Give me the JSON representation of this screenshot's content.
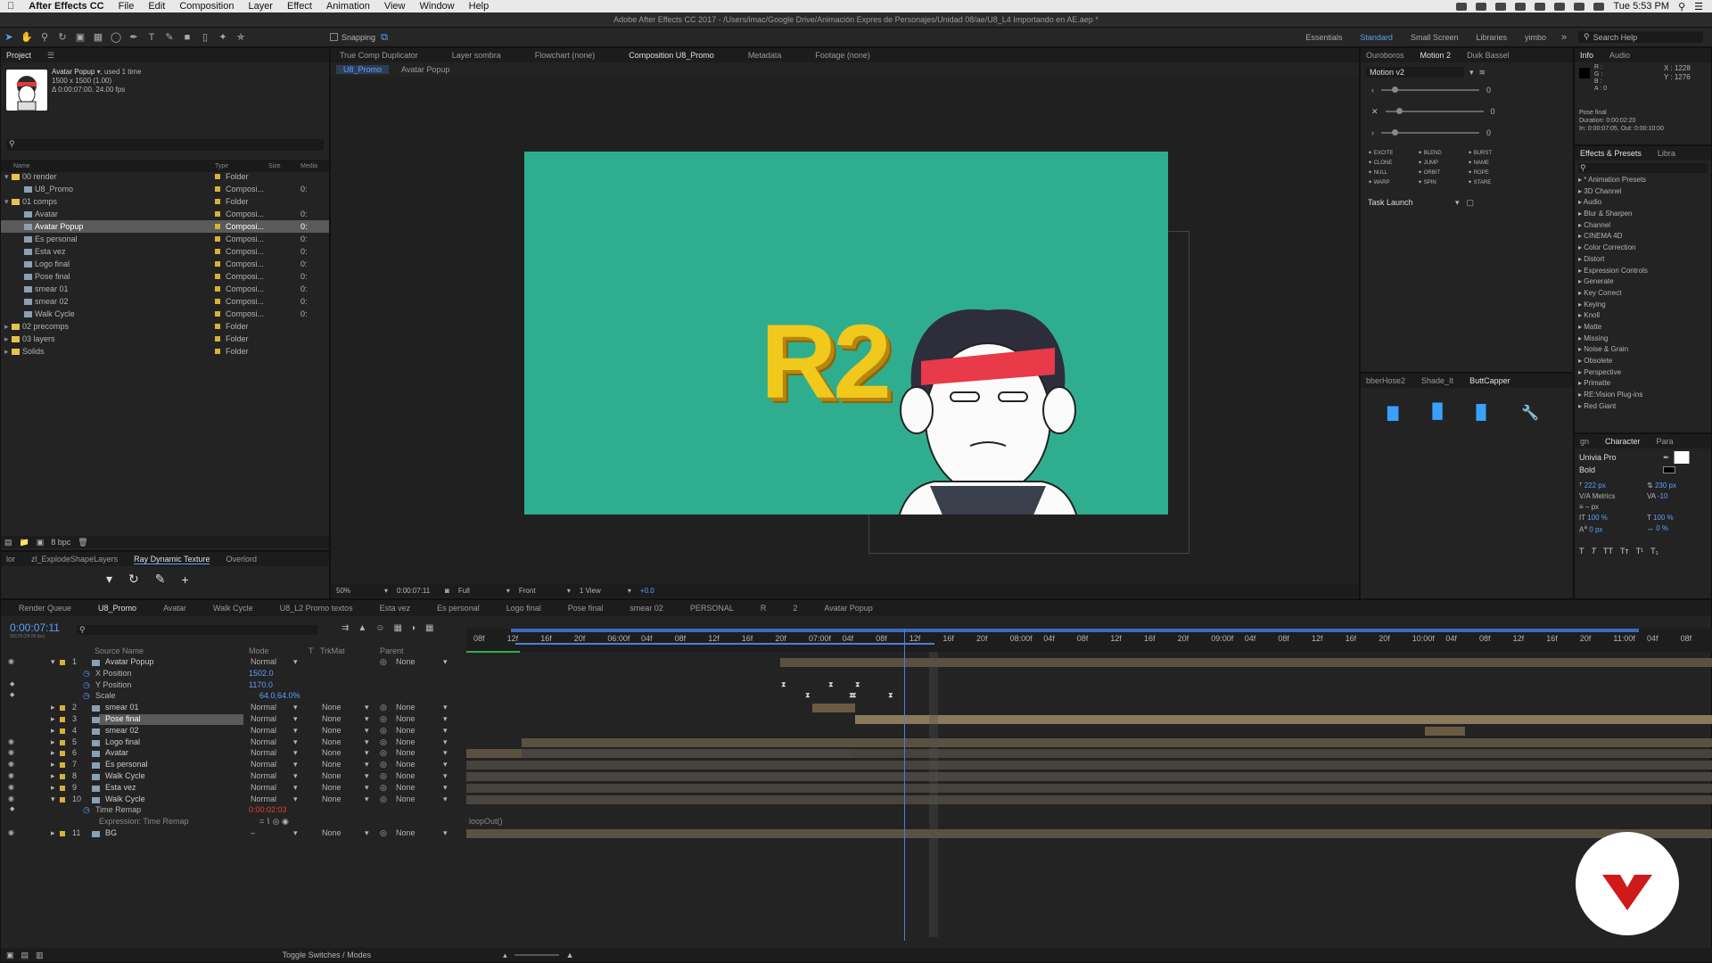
{
  "menubar": {
    "app": "After Effects CC",
    "items": [
      "File",
      "Edit",
      "Composition",
      "Layer",
      "Effect",
      "Animation",
      "View",
      "Window",
      "Help"
    ],
    "clock": "Tue 5:53 PM"
  },
  "window_title": "Adobe After Effects CC 2017 - /Users/imac/Google Drive/Animación Expres de Personajes/Unidad 08/ae/U8_L4 Importando en AE.aep *",
  "toolbar": {
    "snapping": "Snapping",
    "workspaces": [
      "Essentials",
      "Standard",
      "Small Screen",
      "Libraries",
      "yimbo"
    ],
    "active_workspace": "Standard",
    "search_help": "Search Help"
  },
  "project": {
    "tab": "Project",
    "selected_name": "Avatar Popup",
    "used": ", used 1 time",
    "dims": "1500 x 1500 (1.00)",
    "duration": "Δ 0:00:07:00, 24.00 fps",
    "columns": [
      "Name",
      "Type",
      "Size",
      "Media"
    ],
    "items": [
      {
        "indent": 0,
        "name": "00 render",
        "type": "Folder",
        "kind": "folder",
        "open": true
      },
      {
        "indent": 1,
        "name": "U8_Promo",
        "type": "Composi...",
        "kind": "comp",
        "media": "0:"
      },
      {
        "indent": 0,
        "name": "01 comps",
        "type": "Folder",
        "kind": "folder",
        "open": true
      },
      {
        "indent": 1,
        "name": "Avatar",
        "type": "Composi...",
        "kind": "comp",
        "media": "0:"
      },
      {
        "indent": 1,
        "name": "Avatar Popup",
        "type": "Composi...",
        "kind": "comp",
        "media": "0:",
        "selected": true
      },
      {
        "indent": 1,
        "name": "Es personal",
        "type": "Composi...",
        "kind": "comp",
        "media": "0:"
      },
      {
        "indent": 1,
        "name": "Esta vez",
        "type": "Composi...",
        "kind": "comp",
        "media": "0:"
      },
      {
        "indent": 1,
        "name": "Logo final",
        "type": "Composi...",
        "kind": "comp",
        "media": "0:"
      },
      {
        "indent": 1,
        "name": "Pose final",
        "type": "Composi...",
        "kind": "comp",
        "media": "0:"
      },
      {
        "indent": 1,
        "name": "smear 01",
        "type": "Composi...",
        "kind": "comp",
        "media": "0:"
      },
      {
        "indent": 1,
        "name": "smear 02",
        "type": "Composi...",
        "kind": "comp",
        "media": "0:"
      },
      {
        "indent": 1,
        "name": "Walk Cycle",
        "type": "Composi...",
        "kind": "comp",
        "media": "0:"
      },
      {
        "indent": 0,
        "name": "02 precomps",
        "type": "Folder",
        "kind": "folder"
      },
      {
        "indent": 0,
        "name": "03 layers",
        "type": "Folder",
        "kind": "folder"
      },
      {
        "indent": 0,
        "name": "Solids",
        "type": "Folder",
        "kind": "folder"
      }
    ],
    "bpc": "8 bpc"
  },
  "bottom_left_tabs": [
    "lor",
    "zl_ExplodeShapeLayers",
    "Ray Dynamic Texture",
    "Overlord"
  ],
  "comp_viewer": {
    "tabs": [
      "True Comp Duplicator",
      "Layer sombra",
      "Flowchart (none)",
      "Composition U8_Promo",
      "Metadata",
      "Footage (none)"
    ],
    "breadcrumbs": [
      "U8_Promo",
      "Avatar Popup"
    ],
    "logo_text": "R2",
    "footer": {
      "zoom": "50%",
      "timecode": "0:00:07:11",
      "resolution": "Full",
      "view": "Front",
      "views": "1 View",
      "offset": "+0.0"
    }
  },
  "motion_panel": {
    "tabs": [
      "Ouroboros",
      "Motion 2",
      "Duik Bassel"
    ],
    "preset": "Motion v2",
    "slider_values": [
      "0",
      "0",
      "0"
    ],
    "buttons": [
      "EXCITE",
      "BLEND",
      "BURST",
      "CLONE",
      "JUMP",
      "NAME",
      "NULL",
      "ORBIT",
      "ROPE",
      "WARP",
      "SPIN",
      "STARE"
    ],
    "task": "Task Launch"
  },
  "butt_panel": {
    "tabs": [
      "bberHose2",
      "Shade_It",
      "ButtCapper"
    ]
  },
  "info_panel": {
    "tabs": [
      "Info",
      "Audio"
    ],
    "rgb": [
      "R :",
      "G :",
      "B :",
      "A : 0"
    ],
    "xy": [
      "X : 1228",
      "Y : 1276"
    ],
    "layer": "Pose final",
    "duration": "Duration: 0:00:02:20",
    "inout": "In: 0:00:07:05, Out: 0:00:10:00"
  },
  "effects_panel": {
    "tabs": [
      "Effects & Presets",
      "Libra"
    ],
    "items": [
      "* Animation Presets",
      "3D Channel",
      "Audio",
      "Blur & Sharpen",
      "Channel",
      "CINEMA 4D",
      "Color Correction",
      "Distort",
      "Expression Controls",
      "Generate",
      "Key Correct",
      "Keying",
      "Knoll",
      "Matte",
      "Missing",
      "Noise & Grain",
      "Obsolete",
      "Perspective",
      "Primatte",
      "RE:Vision Plug-ins",
      "Red Giant"
    ]
  },
  "character_panel": {
    "tabs": [
      "gn",
      "Character",
      "Para"
    ],
    "font": "Univia Pro",
    "style": "Bold",
    "size": "222 px",
    "leading": "230 px",
    "kern": "Metrics",
    "track": "-10",
    "stroke": "– px",
    "vscale": "100 %",
    "hscale": "100 %",
    "baseline": "0 px",
    "tsume": "0 %"
  },
  "timeline": {
    "tabs": [
      "Render Queue",
      "U8_Promo",
      "Avatar",
      "Walk Cycle",
      "U8_L2 Promo textos",
      "Esta vez",
      "Es personal",
      "Logo final",
      "Pose final",
      "smear 02",
      "PERSONAL",
      "R",
      "2",
      "Avatar Popup"
    ],
    "active_tab": "U8_Promo",
    "timecode": "0:00:07:11",
    "fps": "00179 (24.00 fps)",
    "headers": [
      "Source Name",
      "Mode",
      "T",
      "TrkMat",
      "Parent"
    ],
    "ruler": [
      "08f",
      "12f",
      "16f",
      "20f",
      "06:00f",
      "04f",
      "08f",
      "12f",
      "16f",
      "20f",
      "07:00f",
      "04f",
      "08f",
      "12f",
      "16f",
      "20f",
      "08:00f",
      "04f",
      "08f",
      "12f",
      "16f",
      "20f",
      "09:00f",
      "04f",
      "08f",
      "12f",
      "16f",
      "20f",
      "10:00f",
      "04f",
      "08f",
      "12f",
      "16f",
      "20f",
      "11:00f",
      "04f",
      "08f"
    ],
    "rows": [
      {
        "num": "1",
        "name": "Avatar Popup",
        "mode": "Normal",
        "trk": "",
        "parent": "None",
        "open": true,
        "eye": true
      },
      {
        "prop": "X Position",
        "value": "1502.0"
      },
      {
        "prop": "Y Position",
        "value": "1170.0",
        "keyed": true
      },
      {
        "prop": "Scale",
        "value": "64.0,64.0%",
        "keyed": true
      },
      {
        "num": "2",
        "name": "smear 01",
        "mode": "Normal",
        "trk": "None",
        "parent": "None"
      },
      {
        "num": "3",
        "name": "Pose final",
        "mode": "Normal",
        "trk": "None",
        "parent": "None",
        "selected": true
      },
      {
        "num": "4",
        "name": "smear 02",
        "mode": "Normal",
        "trk": "None",
        "parent": "None"
      },
      {
        "num": "5",
        "name": "Logo final",
        "mode": "Normal",
        "trk": "None",
        "parent": "None",
        "eye": true
      },
      {
        "num": "6",
        "name": "Avatar",
        "mode": "Normal",
        "trk": "None",
        "parent": "None",
        "eye": true
      },
      {
        "num": "7",
        "name": "Es personal",
        "mode": "Normal",
        "trk": "None",
        "parent": "None",
        "eye": true
      },
      {
        "num": "8",
        "name": "Walk Cycle",
        "mode": "Normal",
        "trk": "None",
        "parent": "None",
        "eye": true
      },
      {
        "num": "9",
        "name": "Esta vez",
        "mode": "Normal",
        "trk": "None",
        "parent": "None",
        "eye": true
      },
      {
        "num": "10",
        "name": "Walk Cycle",
        "mode": "Normal",
        "trk": "None",
        "parent": "None",
        "eye": true,
        "open": true
      },
      {
        "prop": "Time Remap",
        "value": "0:00:02:03",
        "red": true,
        "keyed": true
      },
      {
        "expr": "Expression: Time Remap",
        "code": "loopOut()"
      },
      {
        "num": "11",
        "name": "BG",
        "mode": "–",
        "trk": "None",
        "parent": "None",
        "eye": true
      }
    ],
    "toggle": "Toggle Switches / Modes"
  }
}
